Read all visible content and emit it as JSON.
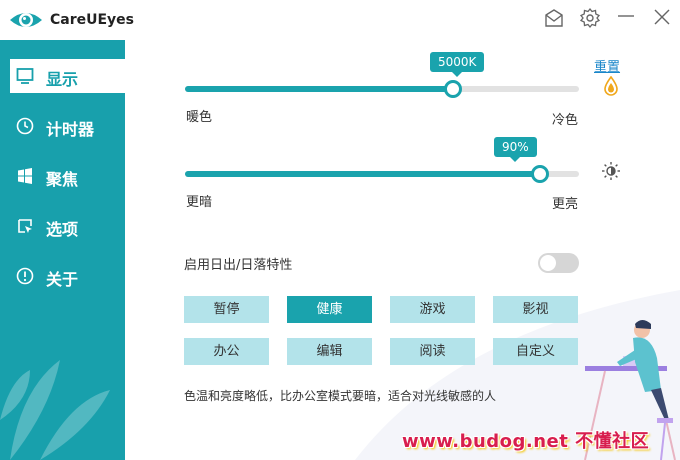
{
  "app": {
    "title": "CareUEyes"
  },
  "titlebar": {
    "icons": [
      "mail-icon",
      "gear-icon",
      "minimize-icon",
      "close-icon"
    ]
  },
  "sidebar": {
    "items": [
      {
        "label": "显示",
        "icon": "monitor-icon",
        "active": true
      },
      {
        "label": "计时器",
        "icon": "clock-icon",
        "active": false
      },
      {
        "label": "聚焦",
        "icon": "windows-icon",
        "active": false
      },
      {
        "label": "选项",
        "icon": "cursor-icon",
        "active": false
      },
      {
        "label": "关于",
        "icon": "info-icon",
        "active": false
      }
    ]
  },
  "display": {
    "color_temp": {
      "value_label": "5000K",
      "value_fraction": 0.68,
      "left_label": "暖色",
      "right_label": "冷色"
    },
    "brightness": {
      "value_label": "90%",
      "value_percent": 90,
      "left_label": "更暗",
      "right_label": "更亮"
    },
    "reset_label": "重置",
    "sunrise_sunset": {
      "label": "启用日出/日落特性",
      "enabled": false
    },
    "modes": [
      {
        "label": "暂停",
        "active": false
      },
      {
        "label": "健康",
        "active": true
      },
      {
        "label": "游戏",
        "active": false
      },
      {
        "label": "影视",
        "active": false
      },
      {
        "label": "办公",
        "active": false
      },
      {
        "label": "编辑",
        "active": false
      },
      {
        "label": "阅读",
        "active": false
      },
      {
        "label": "自定义",
        "active": false
      }
    ],
    "description": "色温和亮度略低，比办公室模式要暗，适合对光线敏感的人"
  },
  "watermark": {
    "text": "www.budog.net 不懂社区"
  },
  "colors": {
    "accent": "#1aa3ad",
    "sidebar": "#18a0ac",
    "mode_inactive": "#b3e3ea",
    "link": "#1a86c9"
  }
}
